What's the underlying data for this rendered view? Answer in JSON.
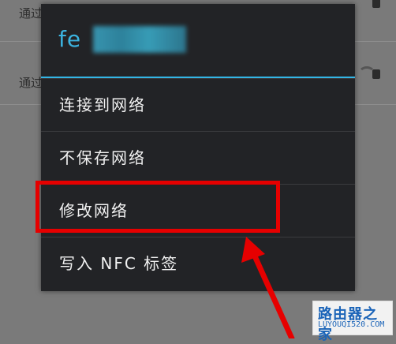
{
  "background_list": {
    "rows": [
      {
        "label": "通过"
      },
      {
        "label": "通过"
      }
    ]
  },
  "dialog": {
    "title": "fe",
    "menu": [
      {
        "label": "连接到网络"
      },
      {
        "label": "不保存网络"
      },
      {
        "label": "修改网络"
      },
      {
        "label": "写入 NFC 标签"
      }
    ]
  },
  "annotation": {
    "highlighted_item": "修改网络",
    "color": "#e60000"
  },
  "watermark": {
    "title": "路由器之家",
    "url": "LUYOUQI520.COM"
  },
  "colors": {
    "accent": "#33b5e5",
    "dialog_bg": "#222326"
  }
}
